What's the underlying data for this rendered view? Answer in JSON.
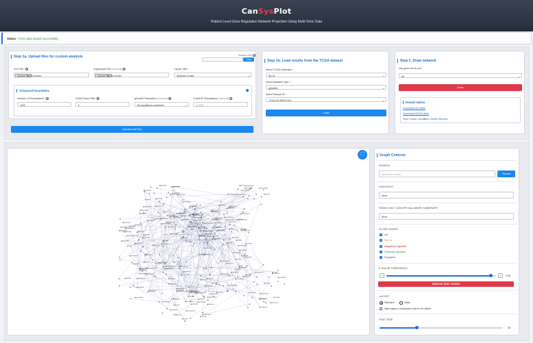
{
  "header": {
    "title_before": "Can",
    "title_accent": "Sys",
    "title_after": "Plot",
    "subtitle": "Patient Level Gene Regulation Network Projection Using Multi Omic Data",
    "accent_color": "#e8394a"
  },
  "status": {
    "label": "Status:",
    "message": "TCGA data loaded successfully!"
  },
  "step1a": {
    "title": "Step 1a. Upload files for custom analysis",
    "session_label": "Session UUID",
    "copy_label": "Copy",
    "vcf_label": "VCF File",
    "expression_label": "Expression File",
    "expression_optional": "(Optional)",
    "cancer_label": "Cancer Site",
    "choose_file": "Choose File",
    "no_file": "No file chosen",
    "cancer_value": "Ampulla of Vater",
    "advanced_label": "Advanced Parameters",
    "permutations_label": "Number of Permutations",
    "permutations_value": "1000",
    "cadd_label": "CADD Score Filter",
    "cadd_value": "0",
    "gnomad_label": "gnomAD Population",
    "gnomad_optional": "(Optional)",
    "gnomad_value": "All populations combined",
    "cutoff_label": "Cutoff AF (Population)",
    "cutoff_optional": "(Optional)",
    "cutoff_placeholder": "0.0005",
    "upload_button": "Upload and Run"
  },
  "step1b": {
    "title": "Step 1b. Load results from the TCGA dataset",
    "collection_label": "Select TCGA Collection",
    "collection_value": "BLCA",
    "mutation_label": "Select Mutation Type",
    "mutation_value": "germline",
    "sample_label": "Select Sample ID",
    "sample_value": "TCGA-2F-A9KO-01A",
    "load_button": "Load"
  },
  "step2": {
    "title": "Step 2. Draw network",
    "gene_set_label": "Use gene set for plot",
    "gene_set_value": "All",
    "draw_button": "Draw",
    "results_title": "Result tables",
    "download_go": "Download GO table",
    "download_kegg": "Download KEGG table",
    "save_graph": "Save Graph Layout",
    "save_visible": "Save Visible Window"
  },
  "controls": {
    "title": "Graph Controls",
    "search_label": "SEARCH",
    "search_placeholder": "Search for a node...",
    "search_button": "Search",
    "highlight_label": "HIGHLIGHT",
    "highlight_value": "None",
    "hallmark_label": "SHOW ONLY CANCER HALLMARK SUBGRAPH",
    "hallmark_value": "None",
    "filter_label": "FILTER EDGES",
    "filters": [
      {
        "label": "Act",
        "color": "#1f4fbf"
      },
      {
        "label": "Part of",
        "color": "#d87a16"
      },
      {
        "label": "Negatively regulates",
        "color": "#c62828"
      },
      {
        "label": "Positively regulates",
        "color": "#2e8b3a"
      },
      {
        "label": "Regulates",
        "color": "#6a3fa0"
      }
    ],
    "pvalue_label": "P-VALUE THRESHOLD",
    "pvalue_value": "0.05",
    "pvalue_fraction": 0.95,
    "remove_grey": "REMOVE GREY NODES",
    "layout_label": "LAYOUT",
    "layout_options": [
      "Standard",
      "Static"
    ],
    "hide_edges_label": "Hide edges if connected node is not visible",
    "font_size_label": "FONT SIZE",
    "font_size_value": "26",
    "font_size_fraction": 0.3
  }
}
